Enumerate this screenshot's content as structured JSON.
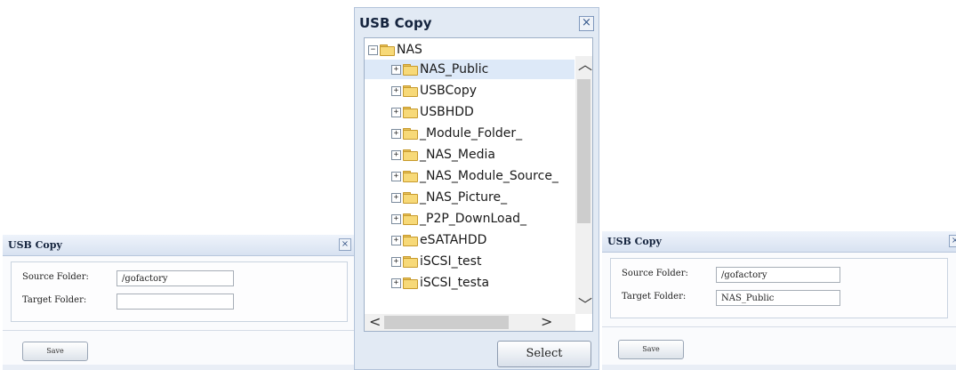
{
  "left_dialog": {
    "title": "USB Copy",
    "close_glyph": "×",
    "source_label": "Source Folder:",
    "source_value": "/gofactory",
    "target_label": "Target Folder:",
    "target_value": "",
    "save_label": "Save"
  },
  "browser_dialog": {
    "title": "USB Copy",
    "close_glyph": "×",
    "select_label": "Select",
    "root": {
      "label": "NAS",
      "toggle": "−"
    },
    "items": [
      {
        "label": "NAS_Public",
        "toggle": "+",
        "selected": true
      },
      {
        "label": "USBCopy",
        "toggle": "+"
      },
      {
        "label": "USBHDD",
        "toggle": "+"
      },
      {
        "label": "_Module_Folder_",
        "toggle": "+"
      },
      {
        "label": "_NAS_Media",
        "toggle": "+"
      },
      {
        "label": "_NAS_Module_Source_",
        "toggle": "+"
      },
      {
        "label": "_NAS_Picture_",
        "toggle": "+"
      },
      {
        "label": "_P2P_DownLoad_",
        "toggle": "+"
      },
      {
        "label": "eSATAHDD",
        "toggle": "+"
      },
      {
        "label": "iSCSI_test",
        "toggle": "+"
      },
      {
        "label": "iSCSI_testa",
        "toggle": "+"
      }
    ],
    "icons": {
      "scroll_up": "chevron-up-icon",
      "scroll_down": "chevron-down-icon",
      "scroll_left": "chevron-left-icon",
      "scroll_right": "chevron-right-icon",
      "folder": "folder-icon"
    }
  },
  "right_dialog": {
    "title": "USB Copy",
    "close_glyph": "×",
    "source_label": "Source Folder:",
    "source_value": "/gofactory",
    "target_label": "Target Folder:",
    "target_value": "NAS_Public",
    "save_label": "Save"
  },
  "colors": {
    "header": "#d8e2f1",
    "selection": "#dde9f8",
    "folder": "#f7d978"
  }
}
